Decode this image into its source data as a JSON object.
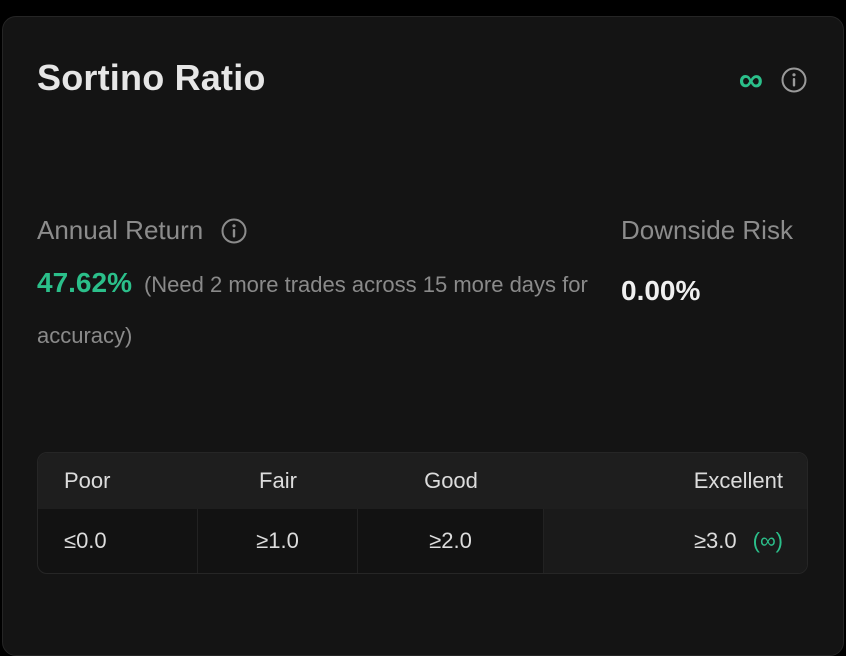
{
  "card": {
    "title": "Sortino Ratio",
    "value_symbol": "∞",
    "accent_color": "#2bbf8a"
  },
  "annual_return": {
    "label": "Annual Return",
    "value": "47.62%",
    "note": "(Need 2 more trades across 15 more days for accuracy)"
  },
  "downside_risk": {
    "label": "Downside Risk",
    "value": "0.00%"
  },
  "scale": {
    "headers": [
      "Poor",
      "Fair",
      "Good",
      "Excellent"
    ],
    "values": [
      "≤0.0",
      "≥1.0",
      "≥2.0",
      "≥3.0"
    ],
    "current_marker": "(∞)"
  },
  "icons": {
    "header_info": "info-icon",
    "annual_info": "info-icon"
  }
}
